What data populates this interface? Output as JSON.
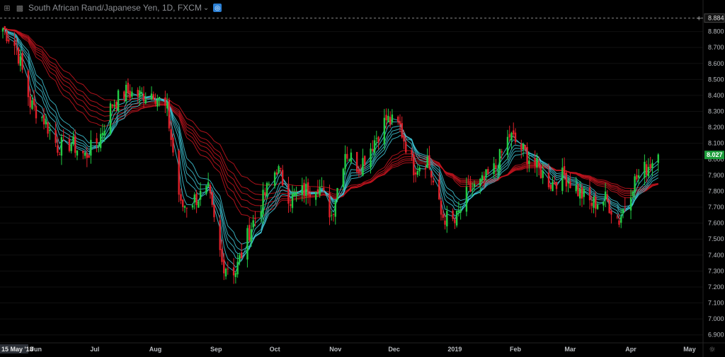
{
  "header": {
    "title": "South African Rand/Japanese Yen, 1D, FXCM",
    "icons": [
      "expand-icon",
      "panel-icon",
      "chevron-down-icon",
      "settings-icon"
    ]
  },
  "colors": {
    "background": "#000000",
    "up": "#22cc44",
    "down": "#e0202a",
    "ribbon_fast": "#3fc8d8",
    "ribbon_slow": "#c0141e",
    "grid": "#101010",
    "last_price_bg": "#1e9e3c"
  },
  "axis": {
    "highlight_value": "8.884",
    "last_price": "8.027",
    "start_date_label": "15 May '18",
    "gear_icon": "gear-icon",
    "crosshair_icon": "plus-icon"
  },
  "chart_data": {
    "type": "candlestick",
    "title": "South African Rand/Japanese Yen, 1D, FXCM",
    "ylim": [
      6.85,
      8.9
    ],
    "y_ticks": [
      "8.800",
      "8.700",
      "8.600",
      "8.500",
      "8.400",
      "8.300",
      "8.200",
      "8.100",
      "8.000",
      "7.900",
      "7.800",
      "7.700",
      "7.600",
      "7.500",
      "7.400",
      "7.300",
      "7.200",
      "7.100",
      "7.000",
      "6.900"
    ],
    "x_ticks": [
      "Jun",
      "Jul",
      "Aug",
      "Sep",
      "Oct",
      "Nov",
      "Dec",
      "2019",
      "Feb",
      "Mar",
      "Apr",
      "May"
    ],
    "highlight_level": 8.884,
    "last_close": 8.027,
    "close_path": [
      [
        "2018-05-15",
        8.82
      ],
      [
        "2018-05-22",
        8.7
      ],
      [
        "2018-05-29",
        8.35
      ],
      [
        "2018-06-05",
        8.25
      ],
      [
        "2018-06-12",
        8.08
      ],
      [
        "2018-06-19",
        8.1
      ],
      [
        "2018-06-26",
        8.02
      ],
      [
        "2018-07-03",
        8.12
      ],
      [
        "2018-07-10",
        8.35
      ],
      [
        "2018-07-17",
        8.42
      ],
      [
        "2018-07-24",
        8.4
      ],
      [
        "2018-07-31",
        8.42
      ],
      [
        "2018-08-07",
        8.3
      ],
      [
        "2018-08-14",
        7.7
      ],
      [
        "2018-08-21",
        7.75
      ],
      [
        "2018-08-28",
        7.8
      ],
      [
        "2018-09-04",
        7.35
      ],
      [
        "2018-09-11",
        7.3
      ],
      [
        "2018-09-18",
        7.55
      ],
      [
        "2018-09-25",
        7.75
      ],
      [
        "2018-10-02",
        7.95
      ],
      [
        "2018-10-09",
        7.75
      ],
      [
        "2018-10-16",
        7.8
      ],
      [
        "2018-10-23",
        7.85
      ],
      [
        "2018-10-30",
        7.65
      ],
      [
        "2018-11-06",
        8.05
      ],
      [
        "2018-11-13",
        7.95
      ],
      [
        "2018-11-20",
        8.1
      ],
      [
        "2018-11-27",
        8.25
      ],
      [
        "2018-12-04",
        8.2
      ],
      [
        "2018-12-11",
        7.95
      ],
      [
        "2018-12-18",
        8.0
      ],
      [
        "2018-12-25",
        7.65
      ],
      [
        "2019-01-01",
        7.6
      ],
      [
        "2019-01-08",
        7.8
      ],
      [
        "2019-01-15",
        7.85
      ],
      [
        "2019-01-22",
        7.95
      ],
      [
        "2019-01-29",
        8.15
      ],
      [
        "2019-02-05",
        8.05
      ],
      [
        "2019-02-12",
        7.95
      ],
      [
        "2019-02-19",
        7.85
      ],
      [
        "2019-02-26",
        7.9
      ],
      [
        "2019-03-05",
        7.8
      ],
      [
        "2019-03-12",
        7.72
      ],
      [
        "2019-03-19",
        7.75
      ],
      [
        "2019-03-26",
        7.62
      ],
      [
        "2019-04-02",
        7.85
      ],
      [
        "2019-04-09",
        7.95
      ],
      [
        "2019-04-15",
        8.03
      ]
    ]
  }
}
